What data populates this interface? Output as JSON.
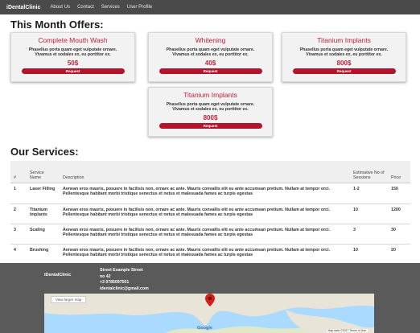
{
  "nav": {
    "brand": "iDentalClinic",
    "links": [
      "About Us",
      "Contact",
      "Services",
      "User Profile"
    ]
  },
  "offers": {
    "title": "This Month Offers:",
    "cards": [
      {
        "title": "Complete Mouth Wash",
        "text": "Phasellus porta quam eget vulputate ornare. Vivamus et sodales ex, eu porttitor ex.",
        "price": "50$",
        "button": "Request"
      },
      {
        "title": "Whitening",
        "text": "Phasellus porta quam eget vulputate ornare. Vivamus et sodales ex, eu porttitor ex.",
        "price": "40$",
        "button": "Request"
      },
      {
        "title": "Titanium Implants",
        "text": "Phasellus porta quam eget vulputate ornare. Vivamus et sodales ex, eu porttitor ex.",
        "price": "800$",
        "button": "Request"
      },
      {
        "title": "Titanium Implants",
        "text": "Phasellus porta quam eget vulputate ornare. Vivamus et sodales ex, eu porttitor ex.",
        "price": "800$",
        "button": "Request"
      }
    ]
  },
  "services": {
    "title": "Our Services:",
    "headers": {
      "num": "#",
      "name": "Service Name",
      "description": "Description",
      "sessions": "Estimative No of Sessions",
      "price": "Price"
    },
    "rows": [
      {
        "num": "1",
        "name": "Laser Filling",
        "description": "Aenean eros mauris, posuere in facilisis non, ornare ac ante. Mauris convallis elit eu ante accumsan pretium. Nullam at tempor orci. Pellentesque habitant morbi tristique senectus et netus et malesuada fames ac turpis egestas",
        "sessions": "1-2",
        "price": "150"
      },
      {
        "num": "2",
        "name": "Titanium implants",
        "description": "Aenean eros mauris, posuere in facilisis non, ornare ac ante. Mauris convallis elit eu ante accumsan pretium. Nullam at tempor orci. Pellentesque habitant morbi tristique senectus et netus et malesuada fames ac turpis egestas",
        "sessions": "10",
        "price": "1200"
      },
      {
        "num": "3",
        "name": "Scaling",
        "description": "Aenean eros mauris, posuere in facilisis non, ornare ac ante. Mauris convallis elit eu ante accumsan pretium. Nullam at tempor orci. Pellentesque habitant morbi tristique senectus et netus et malesuada fames ac turpis egestas",
        "sessions": "3",
        "price": "30"
      },
      {
        "num": "4",
        "name": "Brushing",
        "description": "Aenean eros mauris, posuere in facilisis non, ornare ac ante. Mauris convallis elit eu ante accumsan pretium. Nullam at tempor orci. Pellentesque habitant morbi tristique senectus et netus et malesuada fames ac turpis egestas",
        "sessions": "10",
        "price": "20"
      }
    ]
  },
  "footer": {
    "brand": "iDentalClinic",
    "street": "Street Example Street",
    "number": "no 42",
    "phone": "+3 0785097501",
    "email": "identalclinic@gmail.com",
    "map": {
      "link": "View larger map",
      "google": "Google",
      "attribution": "Map data ©2017   Terms of Use"
    }
  },
  "colors": {
    "accent": "#c0213a",
    "button": "#b3142c",
    "nav": "#4a4a4a",
    "footer": "#5a5a5a"
  },
  "icons": [
    "map-pin-icon"
  ]
}
